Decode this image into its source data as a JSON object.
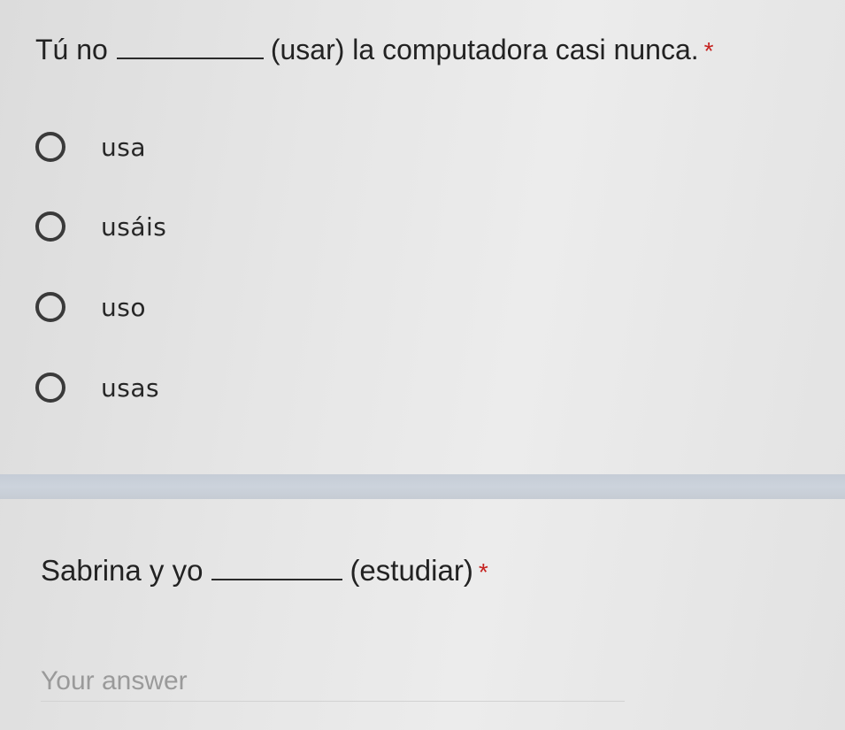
{
  "questions": [
    {
      "prefix": "Tú no",
      "suffix": "(usar) la computadora casi nunca.",
      "required_mark": "*",
      "options": [
        "usa",
        "usáis",
        "uso",
        "usas"
      ]
    },
    {
      "prefix": "Sabrina y yo",
      "suffix": "(estudiar)",
      "required_mark": "*",
      "answer_placeholder": "Your answer"
    }
  ],
  "colors": {
    "required": "#c5221f",
    "divider": "#c9d0d9",
    "radio_border": "#3a3a3a"
  }
}
